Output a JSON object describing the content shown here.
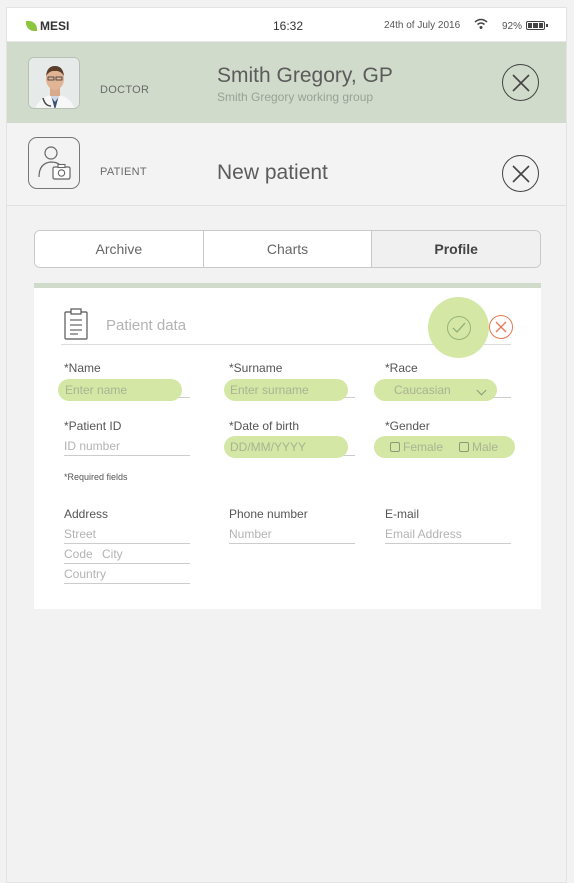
{
  "status_bar": {
    "brand": "MESI",
    "time": "16:32",
    "date": "24th of July 2016",
    "battery": "92%"
  },
  "doctor": {
    "label": "DOCTOR",
    "name": "Smith Gregory, GP",
    "group": "Smith Gregory working group"
  },
  "patient": {
    "label": "PATIENT",
    "title": "New patient"
  },
  "tabs": [
    {
      "label": "Archive"
    },
    {
      "label": "Charts"
    },
    {
      "label": "Profile"
    }
  ],
  "form": {
    "title": "Patient data",
    "name": {
      "label": "*Name",
      "placeholder": "Enter name"
    },
    "surname": {
      "label": "*Surname",
      "placeholder": "Enter surname"
    },
    "race": {
      "label": "*Race",
      "value": "Caucasian"
    },
    "patient_id": {
      "label": "*Patient ID",
      "placeholder": "ID number"
    },
    "dob": {
      "label": "*Date of birth",
      "placeholder": "DD/MM/YYYY"
    },
    "gender": {
      "label": "*Gender",
      "female": "Female",
      "male": "Male"
    },
    "required_note": "*Required fields",
    "address": {
      "label": "Address",
      "street": "Street",
      "code": "Code",
      "city": "City",
      "country": "Country"
    },
    "phone": {
      "label": "Phone number",
      "placeholder": "Number"
    },
    "email": {
      "label": "E-mail",
      "placeholder": "Email Address"
    }
  },
  "colors": {
    "accent_green": "#d4e7a4",
    "header_green": "#d1dbcb",
    "cancel_orange": "#e27a53"
  }
}
